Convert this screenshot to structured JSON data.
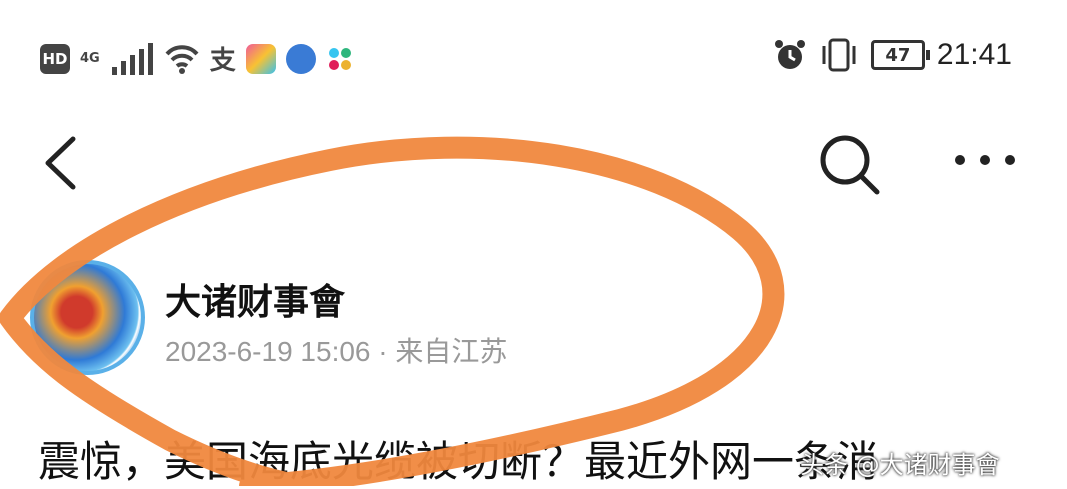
{
  "status_bar": {
    "hd": "HD",
    "network": "4G",
    "time": "21:41",
    "battery": "47",
    "icons": [
      "signal-icon",
      "wifi-icon",
      "alipay-icon",
      "app-icon",
      "music-icon",
      "slack-icon",
      "alarm-icon",
      "vibrate-icon",
      "battery-icon"
    ]
  },
  "navbar": {
    "icons": [
      "back-arrow-icon",
      "search-icon",
      "more-icon"
    ]
  },
  "author": {
    "name": "大诸财事會",
    "meta": "2023-6-19 15:06 · 来自江苏"
  },
  "article": {
    "headline": "震惊，美国海底光缆被切断？最近外网一条消"
  },
  "watermark": "头条 @大诸财事會",
  "colors": {
    "annotation": "#f0883e",
    "meta_text": "#999999",
    "text": "#111111"
  }
}
